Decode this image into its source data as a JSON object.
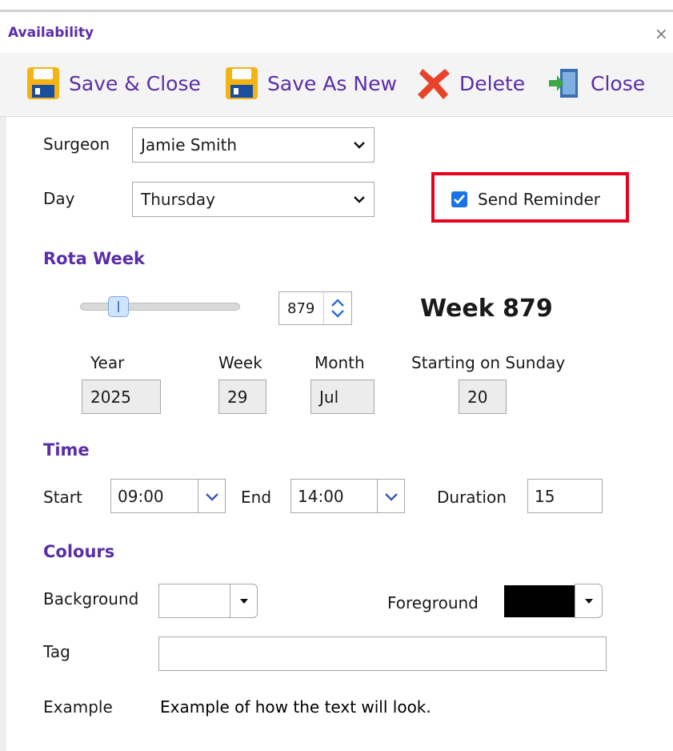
{
  "window": {
    "title": "Availability",
    "close_glyph": "×"
  },
  "toolbar": {
    "save_close": "Save & Close",
    "save_as_new": "Save As New",
    "delete": "Delete",
    "close": "Close"
  },
  "form": {
    "surgeon_label": "Surgeon",
    "surgeon_value": "Jamie Smith",
    "day_label": "Day",
    "day_value": "Thursday",
    "send_reminder_label": "Send Reminder",
    "send_reminder_checked": true
  },
  "rota_week": {
    "section_title": "Rota Week",
    "slider_fraction": 0.2,
    "week_number": "879",
    "week_heading": "Week 879",
    "year_label": "Year",
    "year_value": "2025",
    "week_label": "Week",
    "week_value": "29",
    "month_label": "Month",
    "month_value": "Jul",
    "starting_label": "Starting on Sunday",
    "starting_value": "20"
  },
  "time": {
    "section_title": "Time",
    "start_label": "Start",
    "start_value": "09:00",
    "end_label": "End",
    "end_value": "14:00",
    "duration_label": "Duration",
    "duration_value": "15"
  },
  "colours": {
    "section_title": "Colours",
    "background_label": "Background",
    "background_color": "#ffffff",
    "foreground_label": "Foreground",
    "foreground_color": "#000000",
    "tag_label": "Tag",
    "tag_value": "",
    "example_label": "Example",
    "example_text": "Example of how the text will look."
  },
  "theme": {
    "accent": "#5a2ea6",
    "highlight": "#e8001c",
    "checkbox": "#1a73e8",
    "spinner": "#2b6fd6"
  }
}
